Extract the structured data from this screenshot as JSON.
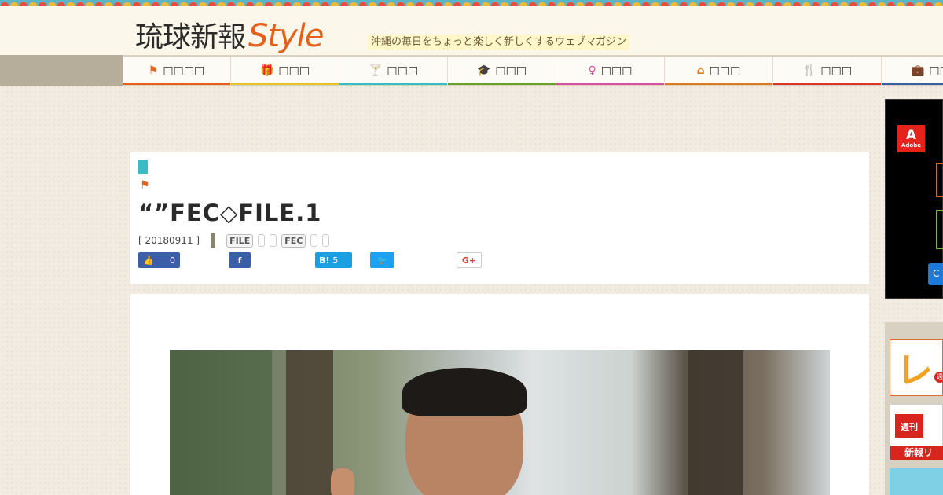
{
  "header": {
    "logo_jp": "琉球新報",
    "logo_style": "Style",
    "tagline": "沖縄の毎日をちょっと楽しく新しくするウェブマガジン"
  },
  "nav": {
    "items": [
      {
        "label": "□□□□",
        "icon": "⚑",
        "icon_name": "flag-icon",
        "color": "#e4611b"
      },
      {
        "label": "□□□",
        "icon": "🎁",
        "icon_name": "gift-icon",
        "color": "#e8c22a"
      },
      {
        "label": "□□□",
        "icon": "🍸",
        "icon_name": "drinks-icon",
        "color": "#3bbcc4"
      },
      {
        "label": "□□□",
        "icon": "🎓",
        "icon_name": "graduation-cap-icon",
        "color": "#6aa12a"
      },
      {
        "label": "□□□",
        "icon": "♀",
        "icon_name": "woman-icon",
        "color": "#d850a0"
      },
      {
        "label": "□□□",
        "icon": "⌂",
        "icon_name": "house-icon",
        "color": "#d97a24"
      },
      {
        "label": "□□□",
        "icon": "🍴",
        "icon_name": "fork-knife-icon",
        "color": "#d8342a"
      },
      {
        "label": "□□□",
        "icon": "💼",
        "icon_name": "briefcase-icon",
        "color": "#3a5fa0"
      }
    ]
  },
  "article": {
    "title": "“”FEC◇FILE.1",
    "date": "[ 20180911 ]",
    "tags": [
      "FILE",
      "FEC"
    ]
  },
  "share": {
    "like_count": "0",
    "fb_label": "f",
    "hatena_label": "B!",
    "hatena_count": "5",
    "twitter_label": "🐦",
    "gplus_label": "G+"
  },
  "sidebar": {
    "adobe_text": "Adobe",
    "adobe_letter": "A",
    "ad_button_text": "C",
    "banner1_big": "レ",
    "banner1_dot": "週",
    "banner2_roof": "週刊",
    "banner2_bottom": "新報リ"
  },
  "colors": {
    "accent": "#e4611b",
    "category": "#3bbcc4",
    "facebook": "#3b5ea8",
    "hatena": "#1aa0e2",
    "twitter": "#1da1f2"
  }
}
